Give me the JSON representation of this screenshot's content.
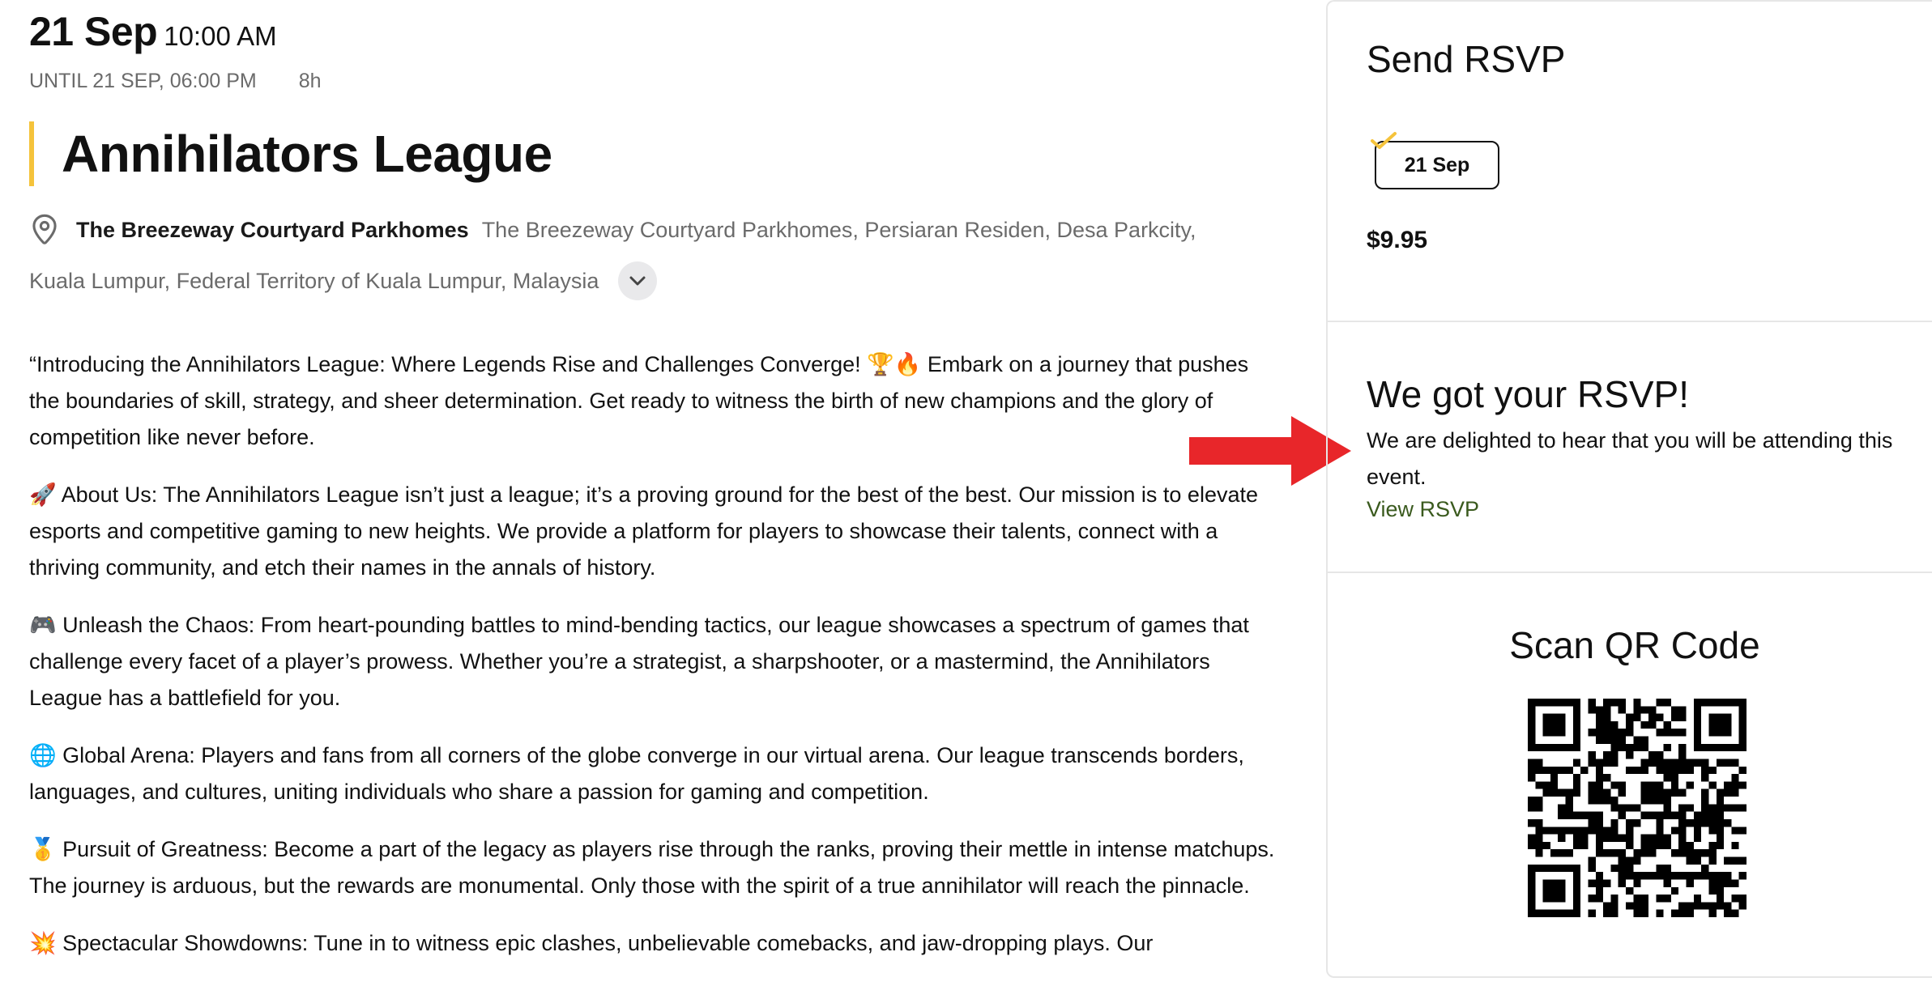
{
  "event": {
    "date": "21 Sep",
    "time": "10:00 AM",
    "until": "UNTIL 21 SEP, 06:00 PM",
    "duration": "8h",
    "title": "Annihilators League",
    "accent_color": "#f5c33b",
    "location": {
      "name": "The Breezeway Courtyard Parkhomes",
      "address_line1": "The Breezeway Courtyard Parkhomes, Persiaran Residen, Desa Parkcity,",
      "address_line2": "Kuala Lumpur, Federal Territory of Kuala Lumpur, Malaysia",
      "pin_icon": "map-pin-icon",
      "expand_icon": "chevron-down-icon"
    },
    "description": [
      "“Introducing the Annihilators League: Where Legends Rise and Challenges Converge! 🏆🔥 Embark on a journey that pushes the boundaries of skill, strategy, and sheer determination. Get ready to witness the birth of new champions and the glory of competition like never before.",
      "🚀 About Us: The Annihilators League isn’t just a league; it’s a proving ground for the best of the best. Our mission is to elevate esports and competitive gaming to new heights. We provide a platform for players to showcase their talents, connect with a thriving community, and etch their names in the annals of history.",
      "🎮 Unleash the Chaos: From heart-pounding battles to mind-bending tactics, our league showcases a spectrum of games that challenge every facet of a player’s prowess. Whether you’re a strategist, a sharpshooter, or a mastermind, the Annihilators League has a battlefield for you.",
      "🌐 Global Arena: Players and fans from all corners of the globe converge in our virtual arena. Our league transcends borders, languages, and cultures, uniting individuals who share a passion for gaming and competition.",
      "🥇 Pursuit of Greatness: Become a part of the legacy as players rise through the ranks, proving their mettle in intense matchups. The journey is arduous, but the rewards are monumental. Only those with the spirit of a true annihilator will reach the pinnacle.",
      "💥 Spectacular Showdowns: Tune in to witness epic clashes, unbelievable comebacks, and jaw-dropping plays. Our"
    ]
  },
  "sidebar": {
    "rsvp": {
      "title": "Send RSVP",
      "selected_date": "21 Sep",
      "check_icon": "checkmark-icon",
      "check_color": "#f5c33b",
      "price": "$9.95"
    },
    "confirmation": {
      "title": "We got your RSVP!",
      "message": "We are delighted to hear that you will be attending this event.",
      "link": "View RSVP",
      "link_color": "#3a5a1e"
    },
    "qr": {
      "title": "Scan QR Code",
      "icon": "qr-code-icon"
    }
  },
  "annotation": {
    "arrow_icon": "red-arrow-icon",
    "arrow_color": "#e8262a"
  }
}
